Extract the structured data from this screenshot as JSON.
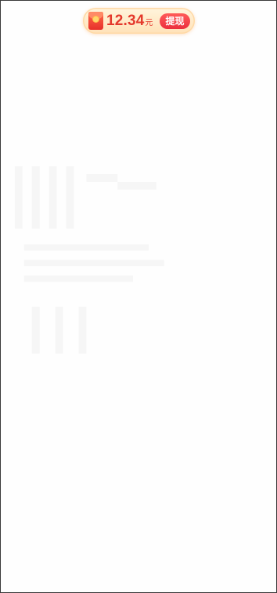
{
  "wallet_pill": {
    "amount": "12.34",
    "currency_unit": "元",
    "withdraw_label": "提现",
    "icon": "red-envelope-icon",
    "colors": {
      "amount": "#e4392c",
      "button": "#ec2e3f",
      "pill_bg": "#ffe2b8"
    }
  }
}
